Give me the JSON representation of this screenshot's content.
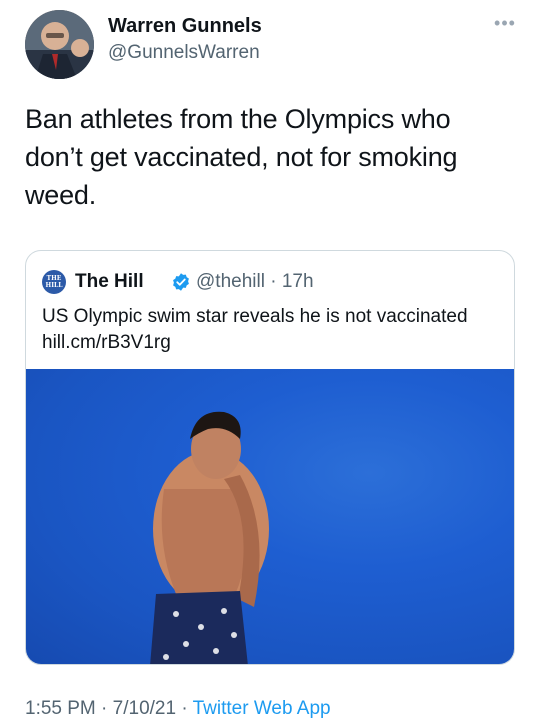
{
  "author": {
    "name": "Warren Gunnels",
    "handle": "@GunnelsWarren",
    "avatar_icon": "profile-photo-avatar"
  },
  "more_icon": "more-options-icon",
  "tweet": {
    "text": "Ban athletes from the Olympics who don’t get vaccinated, not for smoking weed."
  },
  "quoted": {
    "logo_text": "THE HILL",
    "name": "The Hill",
    "verified_icon": "verified-badge-icon",
    "handle": "@thehill",
    "separator": "·",
    "age": "17h",
    "text": "US Olympic swim star reveals he is not vaccinated hill.cm/rB3V1rg",
    "image_icon": "swimmer-photo"
  },
  "footer": {
    "time": "1:55 PM",
    "sep1": " · ",
    "date": "7/10/21",
    "sep2": " · ",
    "app": "Twitter Web App"
  },
  "colors": {
    "link": "#1d9bf0",
    "verified": "#1d9bf0",
    "secondary_text": "#536471"
  }
}
